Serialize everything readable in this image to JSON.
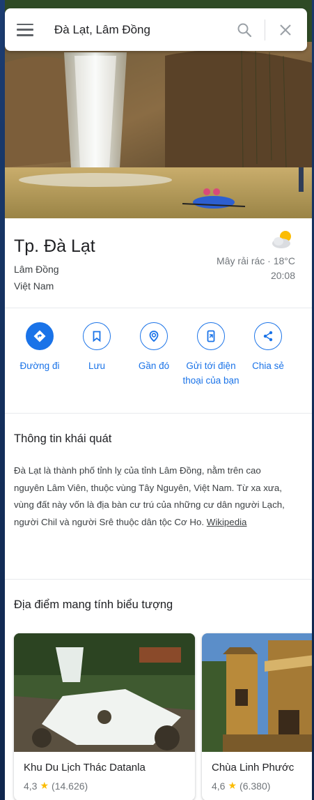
{
  "search": {
    "query": "Đà Lạt, Lâm Đồng"
  },
  "place": {
    "title": "Tp. Đà Lạt",
    "region": "Lâm Đồng",
    "country": "Việt Nam"
  },
  "weather": {
    "condition": "Mây rải rác · 18°C",
    "time": "20:08",
    "icon": "partly-cloudy-icon"
  },
  "actions": [
    {
      "label": "Đường đi",
      "icon": "directions-icon"
    },
    {
      "label": "Lưu",
      "icon": "bookmark-icon"
    },
    {
      "label": "Gần đó",
      "icon": "nearby-icon"
    },
    {
      "label": "Gửi tới điện thoại của bạn",
      "icon": "send-to-phone-icon"
    },
    {
      "label": "Chia sẻ",
      "icon": "share-icon"
    }
  ],
  "overview": {
    "title": "Thông tin khái quát",
    "text": "Đà Lạt là thành phố tỉnh lỵ của tỉnh Lâm Đồng, nằm trên cao nguyên Lâm Viên, thuộc vùng Tây Nguyên, Việt Nam. Từ xa xưa, vùng đất này vốn là địa bàn cư trú của những cư dân người Lạch, người Chil và người Srê thuộc dân tộc Cơ Ho.",
    "source": "Wikipedia"
  },
  "iconic": {
    "title": "Địa điểm mang tính biểu tượng",
    "places": [
      {
        "name": "Khu Du Lịch Thác Datanla",
        "rating": "4,3",
        "reviews": "(14.626)"
      },
      {
        "name": "Chùa Linh Phước",
        "rating": "4,6",
        "reviews": "(6.380)"
      }
    ]
  },
  "colors": {
    "accent": "#1a73e8",
    "star": "#fbbc04",
    "background": "#16325f"
  }
}
